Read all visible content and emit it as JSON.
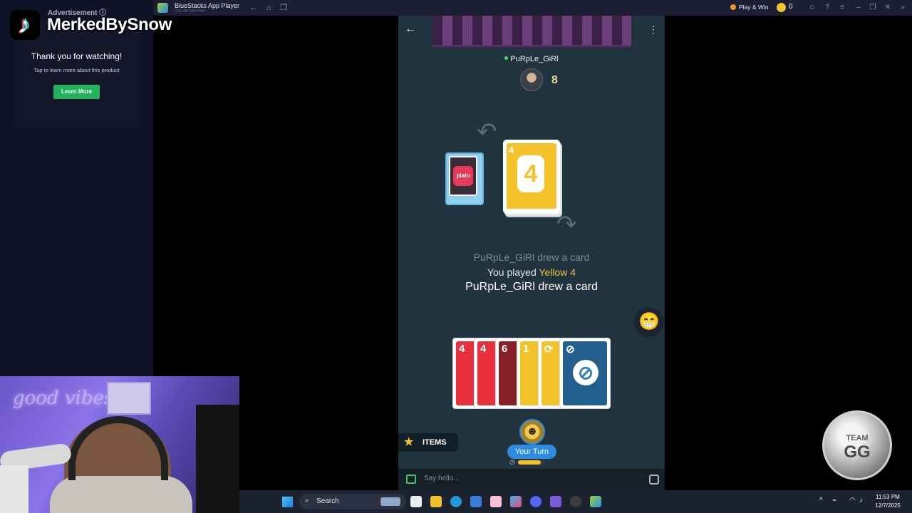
{
  "titlebar": {
    "title": "BlueStacks App Player",
    "version": "5.21.440.1002 P64",
    "play_win": "Play & Win",
    "coins": "0"
  },
  "ad": {
    "header": "Advertisement ⓘ",
    "title": "Thank you for watching!",
    "subtitle": "Tap to learn more about this product",
    "button": "Learn More"
  },
  "stream": {
    "handle": "MerkedBySnow",
    "neon_sign": "good vibes"
  },
  "game": {
    "opponent_name": "PuRpLe_GiRl",
    "opponent_card_count": "8",
    "deck_label": "plato",
    "discard_top": {
      "value": "4",
      "color": "#f4c22b"
    },
    "log": {
      "line1": "PuRpLe_GiRl drew a card",
      "line2_prefix": "You played ",
      "line2_highlight": "Yellow 4",
      "line3": "PuRpLe_GiRl drew a card"
    },
    "emoji": "😁",
    "hand": [
      {
        "value": "4",
        "color": "#e9313d",
        "dim": false
      },
      {
        "value": "4",
        "color": "#e9313d",
        "dim": false
      },
      {
        "value": "6",
        "color": "#b52a34",
        "dim": true
      },
      {
        "value": "1",
        "color": "#f4c22b",
        "dim": false
      },
      {
        "value": "⟳",
        "color": "#f4c22b",
        "dim": false
      },
      {
        "value": "⊘",
        "color": "#2e7fbf",
        "dim": true
      }
    ],
    "items_label": "ITEMS",
    "your_turn": "Your Turn",
    "timer_fraction": 0.85
  },
  "chat": {
    "placeholder": "Say hello..."
  },
  "badge": {
    "line1": "TEAM",
    "line2": "GG"
  },
  "taskbar": {
    "search_label": "Search",
    "time": "11:53 PM",
    "date": "12/7/2025"
  }
}
